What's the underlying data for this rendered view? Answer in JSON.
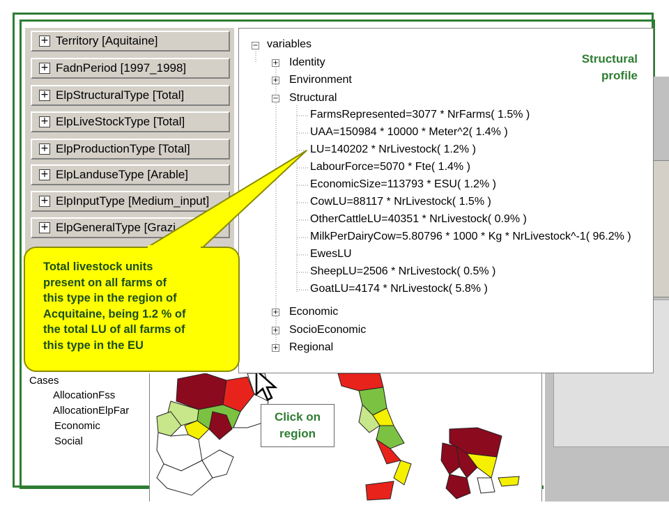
{
  "dimensions": [
    {
      "label": "Territory [Aquitaine]"
    },
    {
      "label": "FadnPeriod [1997_1998]"
    },
    {
      "label": "ElpStructuralType [Total]"
    },
    {
      "label": "ElpLiveStockType [Total]"
    },
    {
      "label": "ElpProductionType [Total]"
    },
    {
      "label": "ElpLanduseType [Arable]"
    },
    {
      "label": "ElpInputType [Medium_input]"
    },
    {
      "label": "ElpGeneralType [Grazi"
    }
  ],
  "tree": {
    "root": "variables",
    "groups_top": [
      "Identity",
      "Environment"
    ],
    "expanded": "Structural",
    "structural_items": [
      "FarmsRepresented=3077 * NrFarms( 1.5% )",
      "UAA=150984 * 10000 * Meter^2( 1.4% )",
      "LU=140202 * NrLivestock( 1.2% )",
      "LabourForce=5070 * Fte( 1.4% )",
      "EconomicSize=113793 * ESU( 1.2% )",
      "CowLU=88117 * NrLivestock( 1.5% )",
      "OtherCattleLU=40351 * NrLivestock( 0.9% )",
      "MilkPerDairyCow=5.80796 * 1000 * Kg * NrLivestock^-1( 96.2% )",
      "EwesLU",
      "SheepLU=2506 * NrLivestock( 0.5% )",
      "GoatLU=4174 * NrLivestock( 5.8% )"
    ],
    "groups_bottom": [
      "Economic",
      "SocioEconomic",
      "Regional"
    ]
  },
  "structural_profile": [
    "Structural",
    "profile"
  ],
  "callout": {
    "lines": [
      "Total livestock units",
      "present on all farms of",
      "this type in the region of",
      "Acquitaine, being 1.2 % of",
      "the total LU of all farms of",
      "this type in the EU"
    ]
  },
  "cases": {
    "title": "Cases",
    "items": [
      "AllocationFss",
      "AllocationElpFar",
      "Economic",
      "Social"
    ]
  },
  "click_label": [
    "Click on",
    "region"
  ],
  "colors": {
    "frame": "#2e7d32",
    "callout": "#ffff00",
    "label_text": "#2e7d32",
    "map_dark": "#8b0a1e",
    "map_red": "#e8231c",
    "map_green": "#7cc242",
    "map_lightgreen": "#c8e68a",
    "map_yellow": "#f5f000"
  }
}
